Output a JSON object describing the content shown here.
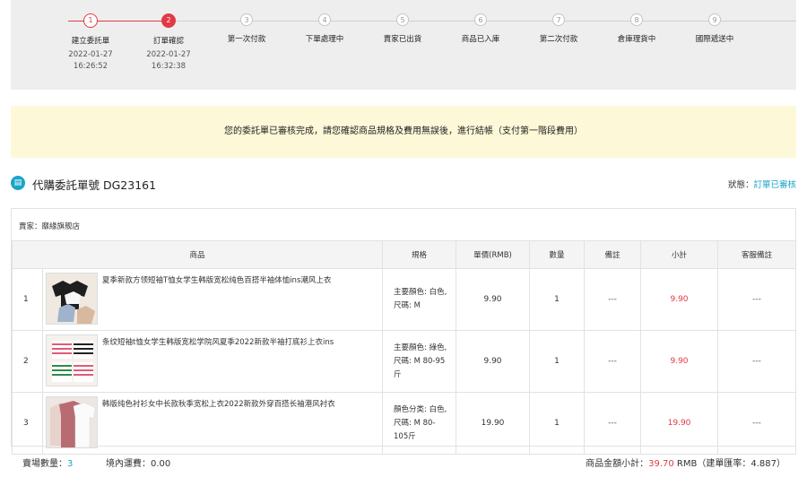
{
  "progress": {
    "steps": [
      {
        "num": "1",
        "label": "建立委託單",
        "date": "2022-01-27",
        "time": "16:26:52"
      },
      {
        "num": "2",
        "label": "訂單確認",
        "date": "2022-01-27",
        "time": "16:32:38"
      },
      {
        "num": "3",
        "label": "第一次付款",
        "date": "",
        "time": ""
      },
      {
        "num": "4",
        "label": "下單處理中",
        "date": "",
        "time": ""
      },
      {
        "num": "5",
        "label": "賣家已出貨",
        "date": "",
        "time": ""
      },
      {
        "num": "6",
        "label": "商品已入庫",
        "date": "",
        "time": ""
      },
      {
        "num": "7",
        "label": "第二次付款",
        "date": "",
        "time": ""
      },
      {
        "num": "8",
        "label": "倉庫理貨中",
        "date": "",
        "time": ""
      },
      {
        "num": "9",
        "label": "國際遞送中",
        "date": "",
        "time": ""
      }
    ],
    "active_color": "#e23a44"
  },
  "notice": {
    "text": "您的委託單已審核完成，請您確認商品規格及費用無誤後，進行結帳（支付第一階段費用）"
  },
  "order": {
    "icon": "document-icon",
    "title": "代購委託單號 DG23161",
    "status_label": "狀態：",
    "status_value": "訂單已審核",
    "status_color": "#1aa5c8"
  },
  "seller": {
    "label": "賣家：",
    "name": "靡緣旗舰店"
  },
  "table": {
    "headers": [
      "商品",
      "規格",
      "單價(RMB)",
      "數量",
      "備註",
      "小計",
      "客服備註"
    ],
    "rows": [
      {
        "index": "1",
        "name": "夏季新款方领短袖T恤女学生韩版宽松纯色百搭半袖体恤ins潮风上衣",
        "spec": "主要顏色: 白色, 尺碼: M",
        "price": "9.90",
        "qty": "1",
        "note": "---",
        "subtotal": "9.90",
        "service_note": "---"
      },
      {
        "index": "2",
        "name": "条纹短袖t恤女学生韩版宽松学院风夏季2022新款半袖打底衫上衣ins",
        "spec": "主要顏色: 綠色, 尺碼: M 80-95斤",
        "price": "9.90",
        "qty": "1",
        "note": "---",
        "subtotal": "9.90",
        "service_note": "---"
      },
      {
        "index": "3",
        "name": "韩版纯色衬衫女中长款秋季宽松上衣2022新款外穿百搭长袖港风衬衣",
        "spec": "顏色分类: 白色, 尺碼: M 80-105斤",
        "price": "19.90",
        "qty": "1",
        "note": "---",
        "subtotal": "19.90",
        "service_note": "---"
      }
    ]
  },
  "footer": {
    "count_label": "賣場數量：",
    "count_value": "3",
    "shipping": "境內運費：0.00",
    "total_label": "商品金額小計：",
    "total_value": "39.70",
    "total_suffix": " RMB（建單匯率：4.887）"
  }
}
